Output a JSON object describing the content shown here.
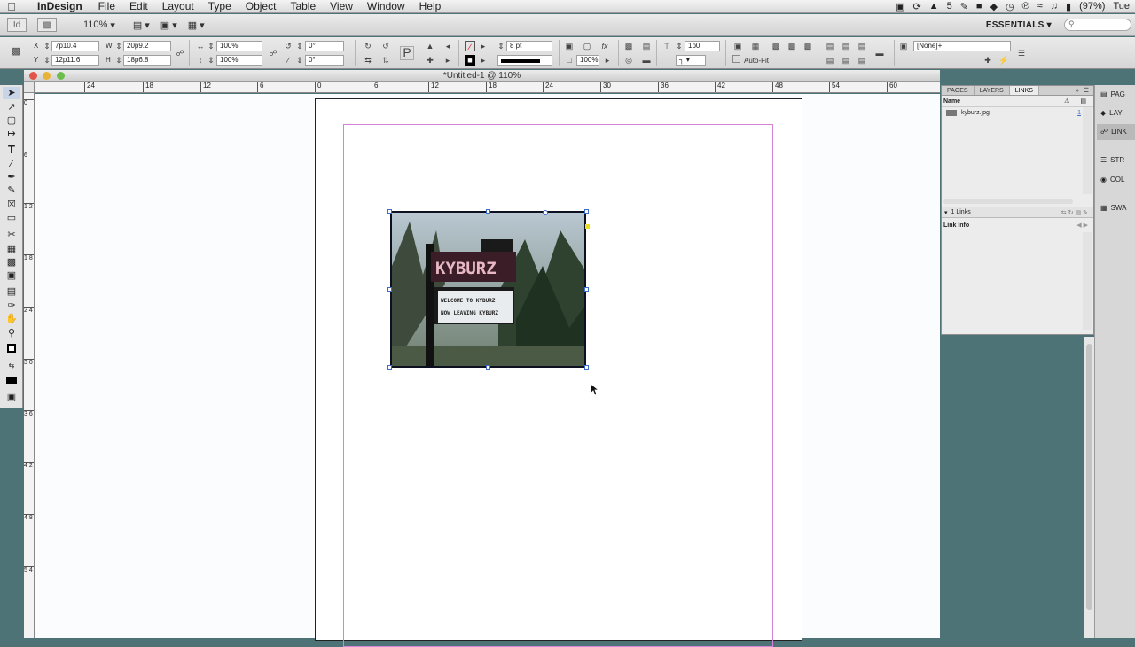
{
  "menubar": {
    "app": "InDesign",
    "items": [
      "File",
      "Edit",
      "Layout",
      "Type",
      "Object",
      "Table",
      "View",
      "Window",
      "Help"
    ],
    "battery": "(97%)",
    "clock": "Tue",
    "adobe_count": "5"
  },
  "appbar": {
    "zoom": "110%",
    "workspace": "ESSENTIALS ▾"
  },
  "control": {
    "x_label": "X",
    "x": "7p10.4",
    "y_label": "Y",
    "y": "12p11.6",
    "w_label": "W",
    "w": "20p9.2",
    "h_label": "H",
    "h": "18p6.8",
    "scale_x": "100%",
    "scale_y": "100%",
    "rotate": "0°",
    "shear": "0°",
    "stroke_weight": "8 pt",
    "opacity": "100%",
    "gap": "1p0",
    "autofit": "Auto-Fit",
    "object_style": "[None]+"
  },
  "document": {
    "title": "*Untitled-1 @ 110%"
  },
  "rulers": {
    "h": [
      "24",
      "18",
      "12",
      "6",
      "0",
      "6",
      "12",
      "18",
      "24",
      "30",
      "36",
      "42",
      "48",
      "54",
      "60"
    ],
    "v": [
      "0",
      "6",
      "1 2",
      "1 8",
      "2 4",
      "3 0",
      "3 6",
      "4 2",
      "4 8",
      "5 4"
    ]
  },
  "image": {
    "sign_top": "KYBURZ",
    "line1": "WELCOME TO KYBURZ",
    "line2": "NOW LEAVING KYBURZ"
  },
  "panel": {
    "tabs": [
      "PAGES",
      "LAYERS",
      "LINKS"
    ],
    "name_header": "Name",
    "link_file": "kyburz.jpg",
    "link_page": "1",
    "links_count": "1 Links",
    "link_info": "Link Info"
  },
  "strip": {
    "items": [
      "PAG",
      "LAY",
      "LINK",
      "STR",
      "COL",
      "SWA"
    ]
  },
  "colors": {
    "accent": "#3d6ccf",
    "margin": "#d384d8",
    "desktop": "#4d7377"
  }
}
